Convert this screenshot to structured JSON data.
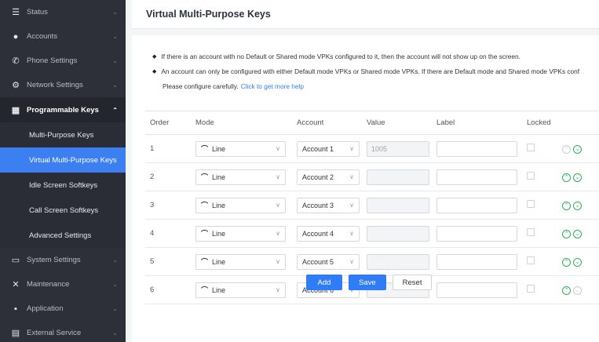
{
  "sidebar": {
    "groups_top": [
      {
        "label": "Status",
        "icon": "list-icon"
      },
      {
        "label": "Accounts",
        "icon": "user-icon"
      },
      {
        "label": "Phone Settings",
        "icon": "phone-icon"
      },
      {
        "label": "Network Settings",
        "icon": "network-icon"
      }
    ],
    "open_group": {
      "label": "Programmable Keys",
      "icon": "keypad-icon"
    },
    "sub_items": [
      "Multi-Purpose Keys",
      "Virtual Multi-Purpose Keys",
      "Idle Screen Softkeys",
      "Call Screen Softkeys",
      "Advanced Settings"
    ],
    "active_sub": 1,
    "groups_bottom": [
      {
        "label": "System Settings",
        "icon": "monitor-icon"
      },
      {
        "label": "Maintenance",
        "icon": "tools-icon"
      },
      {
        "label": "Application",
        "icon": "grid-icon"
      },
      {
        "label": "External Service",
        "icon": "document-icon"
      }
    ]
  },
  "page": {
    "title": "Virtual Multi-Purpose Keys"
  },
  "notes": {
    "line1": "If there is an account with no Default or Shared mode VPKs configured to it, then the account will not show up on the screen.",
    "line2": "An account can only be configured with either Default mode VPKs or Shared mode VPKs. If there are Default mode and Shared mode VPKs conf",
    "careful": "Please configure carefully.",
    "link": "Click to get more help"
  },
  "table": {
    "headers": {
      "order": "Order",
      "mode": "Mode",
      "account": "Account",
      "value": "Value",
      "label": "Label",
      "locked": "Locked"
    },
    "rows": [
      {
        "order": "1",
        "mode": "Line",
        "account": "Account 1",
        "value": "1005",
        "label": "",
        "up_enabled": false,
        "down_enabled": true
      },
      {
        "order": "2",
        "mode": "Line",
        "account": "Account 2",
        "value": "",
        "label": "",
        "up_enabled": true,
        "down_enabled": true
      },
      {
        "order": "3",
        "mode": "Line",
        "account": "Account 3",
        "value": "",
        "label": "",
        "up_enabled": true,
        "down_enabled": true
      },
      {
        "order": "4",
        "mode": "Line",
        "account": "Account 4",
        "value": "",
        "label": "",
        "up_enabled": true,
        "down_enabled": true
      },
      {
        "order": "5",
        "mode": "Line",
        "account": "Account 5",
        "value": "",
        "label": "",
        "up_enabled": true,
        "down_enabled": true
      },
      {
        "order": "6",
        "mode": "Line",
        "account": "Account 6",
        "value": "",
        "label": "",
        "up_enabled": true,
        "down_enabled": false
      }
    ]
  },
  "actions": {
    "add": "Add",
    "save": "Save",
    "reset": "Reset"
  },
  "colors": {
    "sidebar_bg": "#2d3038",
    "active_item": "#3b7ff0",
    "primary_button": "#2f7cf6",
    "move_icon": "#29b256"
  }
}
